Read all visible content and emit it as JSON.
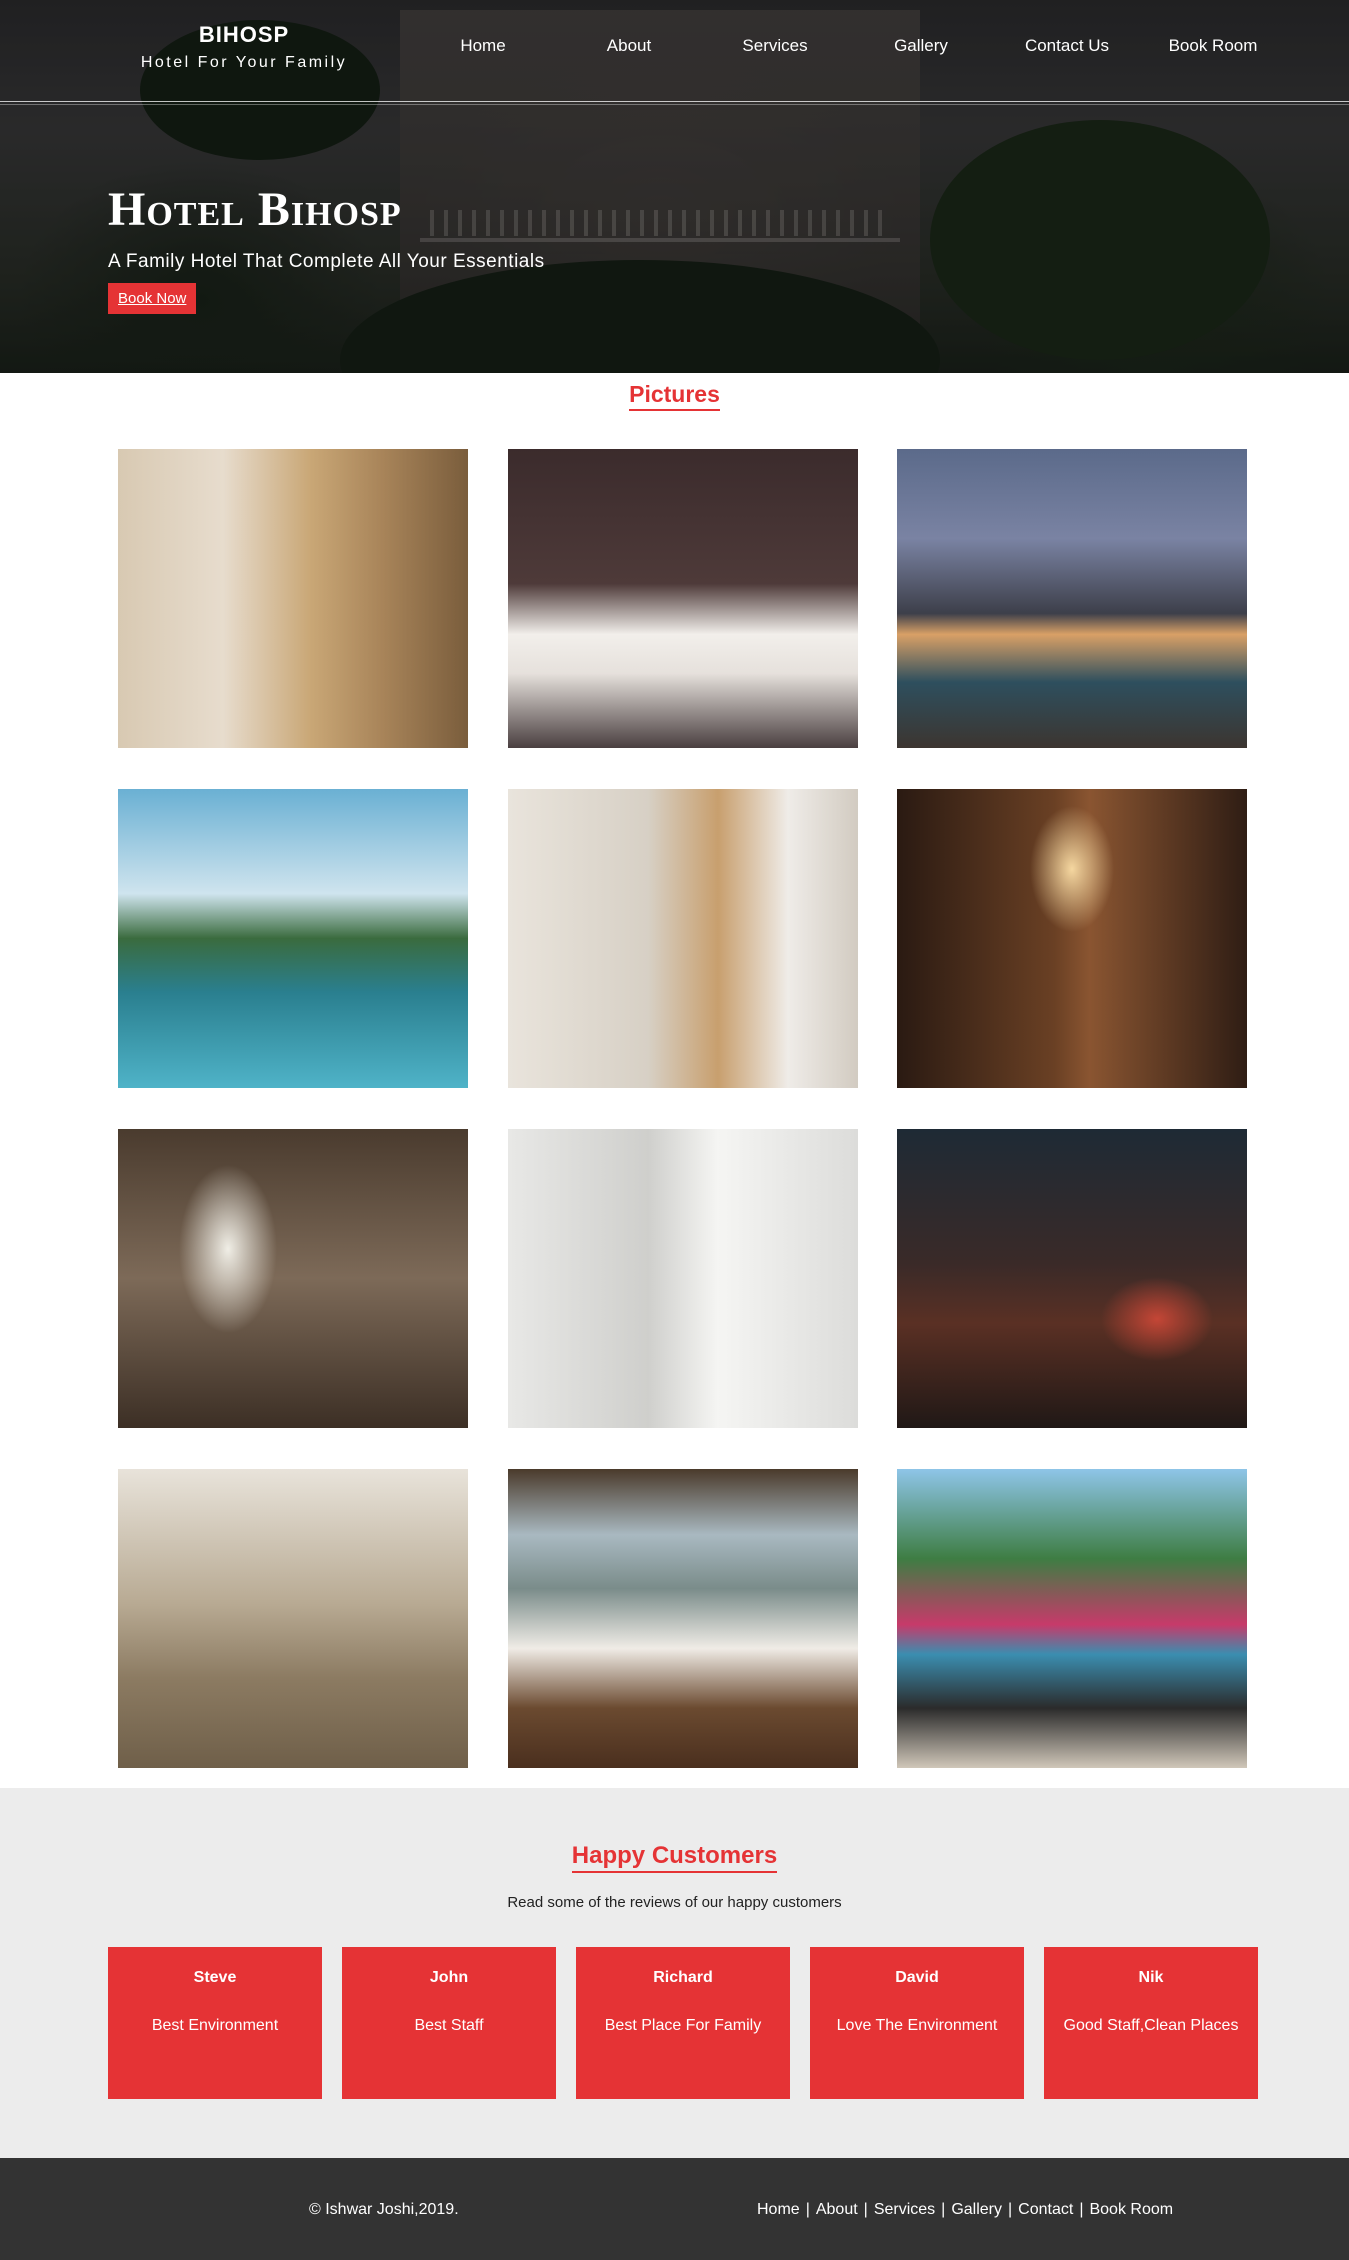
{
  "header": {
    "brand_name": "BIHOSP",
    "brand_tagline": "Hotel For Your Family",
    "nav": [
      "Home",
      "About",
      "Services",
      "Gallery",
      "Contact Us",
      "Book Room"
    ]
  },
  "hero": {
    "title": "Hotel Bihosp",
    "subtitle": "A Family Hotel That Complete All Your Essentials",
    "cta": "Book Now"
  },
  "pictures": {
    "title": "Pictures",
    "images": [
      "door-room",
      "bedroom",
      "pool-night",
      "pool-day",
      "room-modern",
      "hallway",
      "canopy-bed",
      "bathroom",
      "restaurant",
      "towel-swan",
      "dining-view",
      "poolside-breakfast"
    ]
  },
  "happy": {
    "title": "Happy Customers",
    "subtitle": "Read some of the reviews of our happy customers",
    "reviews": [
      {
        "name": "Steve",
        "text": "Best Environment"
      },
      {
        "name": "John",
        "text": "Best Staff"
      },
      {
        "name": "Richard",
        "text": "Best Place For Family"
      },
      {
        "name": "David",
        "text": "Love The Environment"
      },
      {
        "name": "Nik",
        "text": "Good Staff,Clean Places"
      }
    ]
  },
  "footer": {
    "copyright": "© Ishwar Joshi,2019.",
    "links": [
      "Home",
      "About",
      "Services",
      "Gallery",
      "Contact",
      "Book Room"
    ],
    "separator": "|"
  },
  "colors": {
    "accent": "#e53335",
    "footer_bg": "#333333",
    "section_bg": "#ececec"
  }
}
